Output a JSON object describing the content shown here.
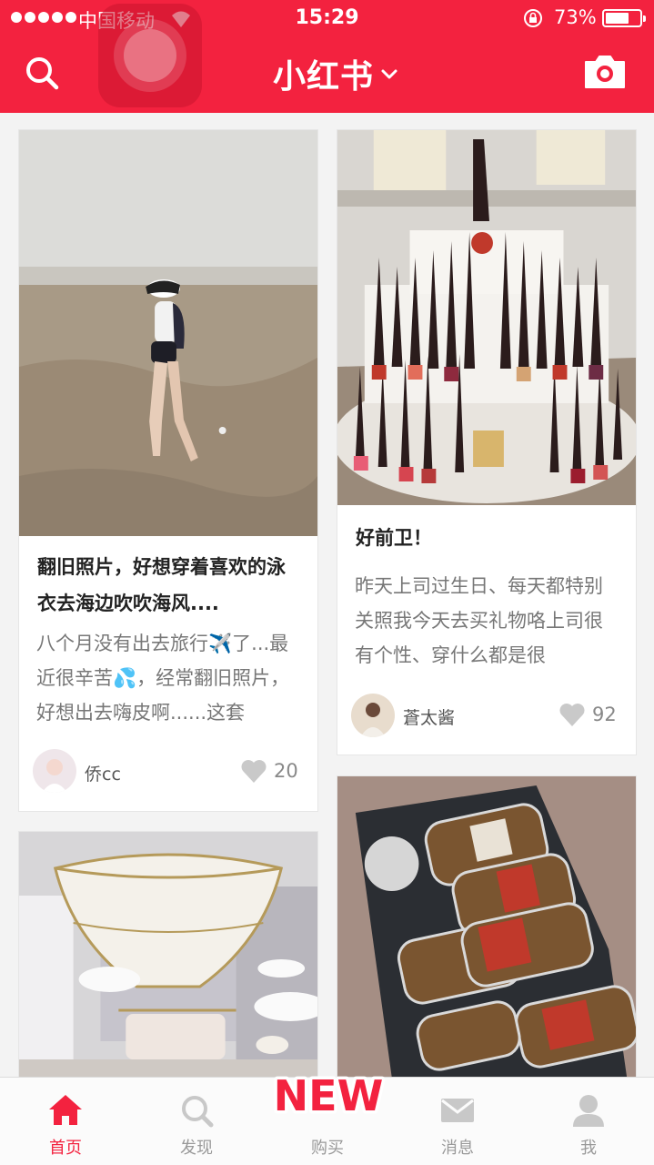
{
  "status_bar": {
    "carrier": "中国移动",
    "time": "15:29",
    "battery_percent": "73%",
    "battery_level": 0.73,
    "icons": [
      "signal-dots-icon",
      "wifi-icon",
      "rotation-lock-icon",
      "battery-icon"
    ]
  },
  "header": {
    "app_name": "小红书",
    "accent_color": "#f3223f",
    "icons": [
      "search-icon",
      "chevron-down-icon",
      "camera-icon",
      "assistive-touch-icon"
    ]
  },
  "feed": {
    "left": [
      {
        "title": "翻旧照片，好想穿着喜欢的泳衣去海边吹吹海风....",
        "desc": "八个月没有出去旅行✈️了...最近很辛苦💦，经常翻旧照片，好想出去嗨皮啊......这套",
        "author": "侨cc",
        "likes": "20"
      },
      {
        "title": "",
        "desc": "",
        "author": "",
        "likes": ""
      }
    ],
    "right": [
      {
        "title": "好前卫！",
        "desc": "昨天上司过生日、每天都特别关照我今天去买礼物咯上司很有个性、穿什么都是很",
        "author": "蒼太酱",
        "likes": "92"
      },
      {
        "title": "",
        "desc": "",
        "author": "",
        "likes": ""
      }
    ]
  },
  "tabbar": {
    "tabs": [
      {
        "label": "首页",
        "icon": "home-icon",
        "active": true
      },
      {
        "label": "发现",
        "icon": "discover-search-icon",
        "active": false
      },
      {
        "label": "购买",
        "icon": "shop-icon",
        "active": false
      },
      {
        "label": "消息",
        "icon": "mail-icon",
        "active": false
      },
      {
        "label": "我",
        "icon": "profile-icon",
        "active": false
      }
    ],
    "badge": "NEW",
    "active_color": "#f3223f",
    "inactive_color": "#999999"
  }
}
